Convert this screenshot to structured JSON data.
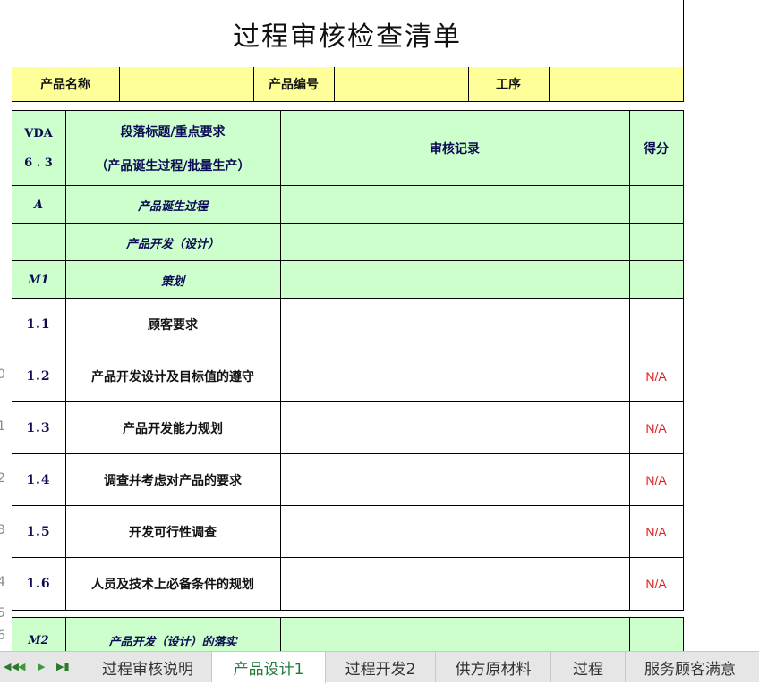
{
  "title": "过程审核检查清单",
  "info_row": {
    "product_name_label": "产品名称",
    "product_code_label": "产品编号",
    "process_label": "工序"
  },
  "header": {
    "vda_line1": "VDA",
    "vda_line2": "6 . 3",
    "section_line1": "段落标题/重点要求",
    "section_line2": "（产品诞生过程/批量生产）",
    "record": "审核记录",
    "score": "得分"
  },
  "group_rows": [
    {
      "code": "A",
      "label": "产品诞生过程"
    },
    {
      "code": "",
      "label": "产品开发（设计）"
    },
    {
      "code": "M1",
      "label": "策划"
    }
  ],
  "items": [
    {
      "num": "1.1",
      "name": "顾客要求",
      "score": ""
    },
    {
      "num": "1.2",
      "name": "产品开发设计及目标值的遵守",
      "score": "N/A"
    },
    {
      "num": "1.3",
      "name": "产品开发能力规划",
      "score": "N/A"
    },
    {
      "num": "1.4",
      "name": "调查并考虑对产品的要求",
      "score": "N/A"
    },
    {
      "num": "1.5",
      "name": "开发可行性调查",
      "score": "N/A"
    },
    {
      "num": "1.6",
      "name": "人员及技术上必备条件的规划",
      "score": "N/A"
    }
  ],
  "m2_row": {
    "code": "M2",
    "label": "产品开发（设计）的落实"
  },
  "row_numbers": [
    "0",
    "1",
    "2",
    "3",
    "4",
    "5",
    "6"
  ],
  "tabs": [
    {
      "label": "过程审核说明",
      "active": false
    },
    {
      "label": "产品设计1",
      "active": true
    },
    {
      "label": "过程开发2",
      "active": false
    },
    {
      "label": "供方原材料",
      "active": false
    },
    {
      "label": "过程",
      "active": false
    },
    {
      "label": "服务顾客满意",
      "active": false
    }
  ],
  "colors": {
    "yellow": "#ffff99",
    "green": "#ccffcc",
    "na_red": "#e02020",
    "active_tab": "#1f7a3a"
  }
}
